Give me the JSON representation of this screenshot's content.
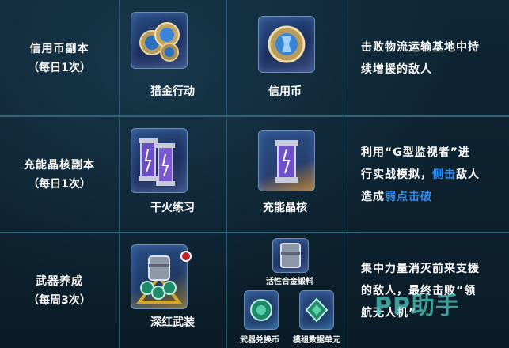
{
  "rows": [
    {
      "label": "信用币副本",
      "sub": "（每日1次）",
      "item1": "猎金行动",
      "item2": "信用币",
      "desc": [
        "击败物流运输基地中持",
        "续增援的敌人"
      ]
    },
    {
      "label": "充能晶核副本",
      "sub": "（每日1次）",
      "item1": "干火练习",
      "item2": "充能晶核",
      "desc_line1": "利用“G型监视者”进",
      "desc_line2_pre": "行实战模拟，",
      "desc_line2_hl": "侧击",
      "desc_line2_post": "敌人",
      "desc_line3_pre": "造成",
      "desc_line3_hl": "弱点击破"
    },
    {
      "label": "武器养成",
      "sub": "（每周3次）",
      "item1": "深红武装",
      "sub_items": [
        "活性合金锻料",
        "武器兑换币",
        "模组数据单元"
      ],
      "desc": [
        "集中力量消灭前来支援",
        "的敌人，最终击败“领",
        "航无人机”"
      ]
    }
  ],
  "watermark": "PP助手",
  "colors": {
    "highlight": "#2f8df0",
    "background": "#0c1f2c",
    "border": "#2e6478"
  },
  "icons": [
    "coins-icon",
    "coin-icon",
    "energy-cores-icon",
    "energy-core-icon",
    "armory-icon",
    "alloy-icon",
    "exchange-coin-icon",
    "module-data-icon"
  ]
}
